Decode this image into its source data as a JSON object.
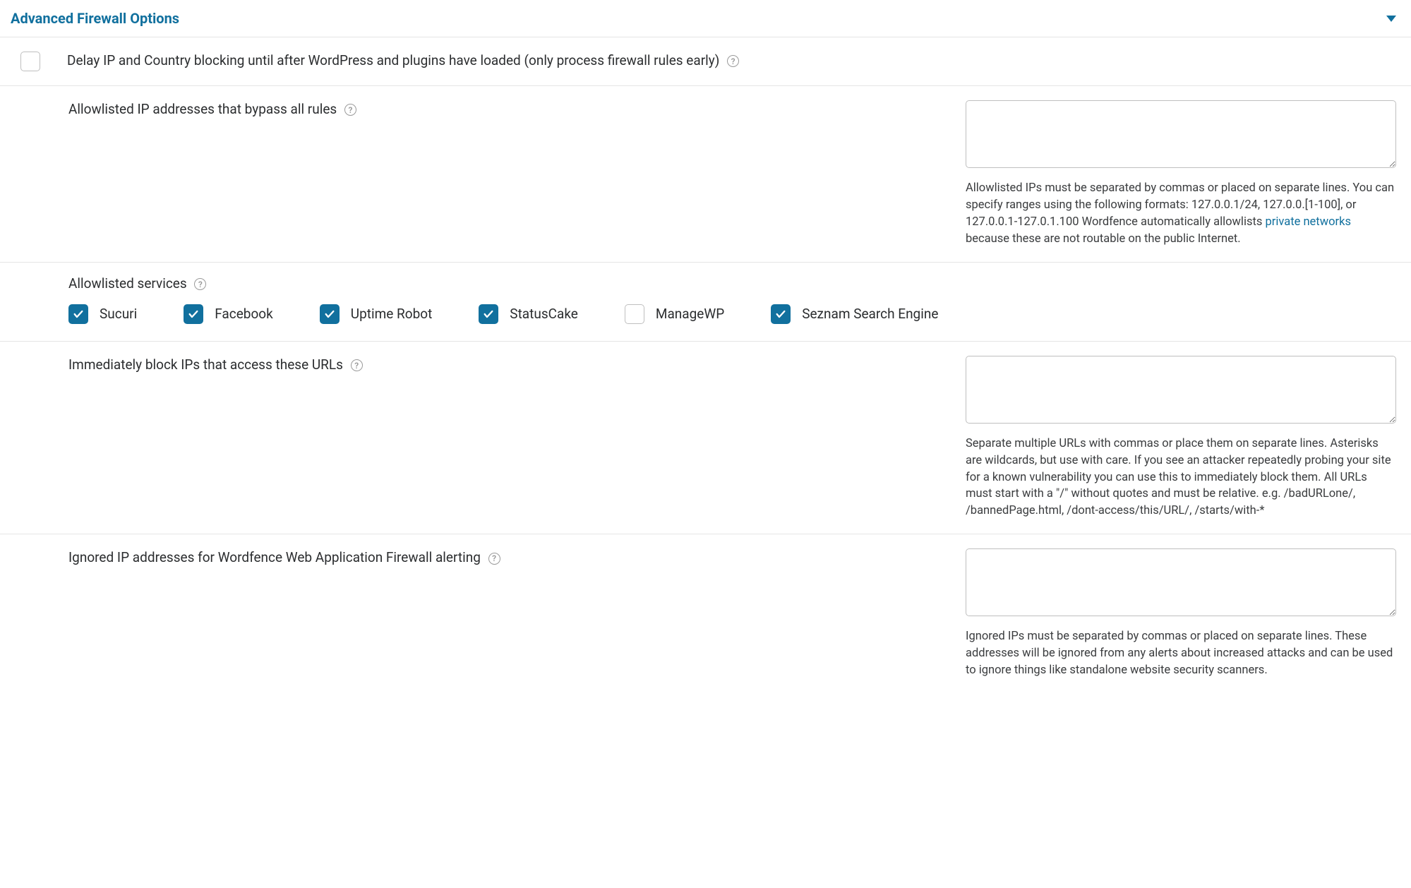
{
  "header": {
    "title": "Advanced Firewall Options"
  },
  "delay": {
    "label": "Delay IP and Country blocking until after WordPress and plugins have loaded (only process firewall rules early)",
    "checked": false
  },
  "allowlist_ips": {
    "label": "Allowlisted IP addresses that bypass all rules",
    "value": "",
    "help_pre": "Allowlisted IPs must be separated by commas or placed on separate lines. You can specify ranges using the following formats: 127.0.0.1/24, 127.0.0.[1-100], or 127.0.0.1-127.0.1.100 Wordfence automatically allowlists ",
    "help_link": "private networks",
    "help_post": " because these are not routable on the public Internet."
  },
  "services": {
    "label": "Allowlisted services",
    "items": [
      {
        "name": "Sucuri",
        "checked": true
      },
      {
        "name": "Facebook",
        "checked": true
      },
      {
        "name": "Uptime Robot",
        "checked": true
      },
      {
        "name": "StatusCake",
        "checked": true
      },
      {
        "name": "ManageWP",
        "checked": false
      },
      {
        "name": "Seznam Search Engine",
        "checked": true
      }
    ]
  },
  "block_urls": {
    "label": "Immediately block IPs that access these URLs",
    "value": "",
    "help": "Separate multiple URLs with commas or place them on separate lines. Asterisks are wildcards, but use with care. If you see an attacker repeatedly probing your site for a known vulnerability you can use this to immediately block them. All URLs must start with a \"/\" without quotes and must be relative. e.g. /badURLone/, /bannedPage.html, /dont-access/this/URL/, /starts/with-*"
  },
  "ignored_ips": {
    "label": "Ignored IP addresses for Wordfence Web Application Firewall alerting",
    "value": "",
    "help": "Ignored IPs must be separated by commas or placed on separate lines. These addresses will be ignored from any alerts about increased attacks and can be used to ignore things like standalone website security scanners."
  },
  "help_glyph": "?"
}
